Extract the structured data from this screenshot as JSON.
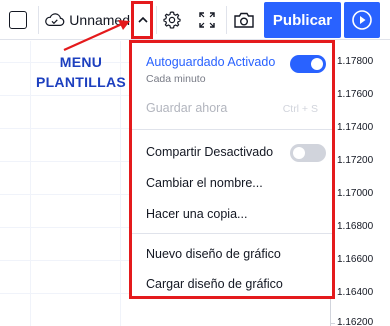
{
  "toolbar": {
    "layout_name": "Unnamed",
    "publish_label": "Publicar",
    "icons": {
      "checkbox": "square-checkbox-icon",
      "cloud": "cloud-check-icon",
      "chevron": "chevron-up-icon",
      "settings": "gear-icon",
      "fullscreen": "fullscreen-icon",
      "snapshot": "camera-icon",
      "play": "play-circle-icon"
    }
  },
  "annotation": {
    "line1": "MENU",
    "line2": "PLANTILLAS",
    "color": "#1c3fbf",
    "arrow_color": "#e41a1c"
  },
  "menu": {
    "autosave_label": "Autoguardado Activado",
    "autosave_sub": "Cada minuto",
    "autosave_on": true,
    "save_now_label": "Guardar ahora",
    "save_now_shortcut": "Ctrl + S",
    "share_label": "Compartir Desactivado",
    "share_on": false,
    "rename_label": "Cambiar el nombre...",
    "copy_label": "Hacer una copia...",
    "new_layout_label": "Nuevo diseño de gráfico",
    "load_layout_label": "Cargar diseño de gráfico",
    "highlight_color": "#e41a1c",
    "accent_color": "#2962ff"
  },
  "price_axis": {
    "labels": [
      "1.17800",
      "1.17600",
      "1.17400",
      "1.17200",
      "1.17000",
      "1.16800",
      "1.16600",
      "1.16400",
      "1.16200"
    ]
  }
}
